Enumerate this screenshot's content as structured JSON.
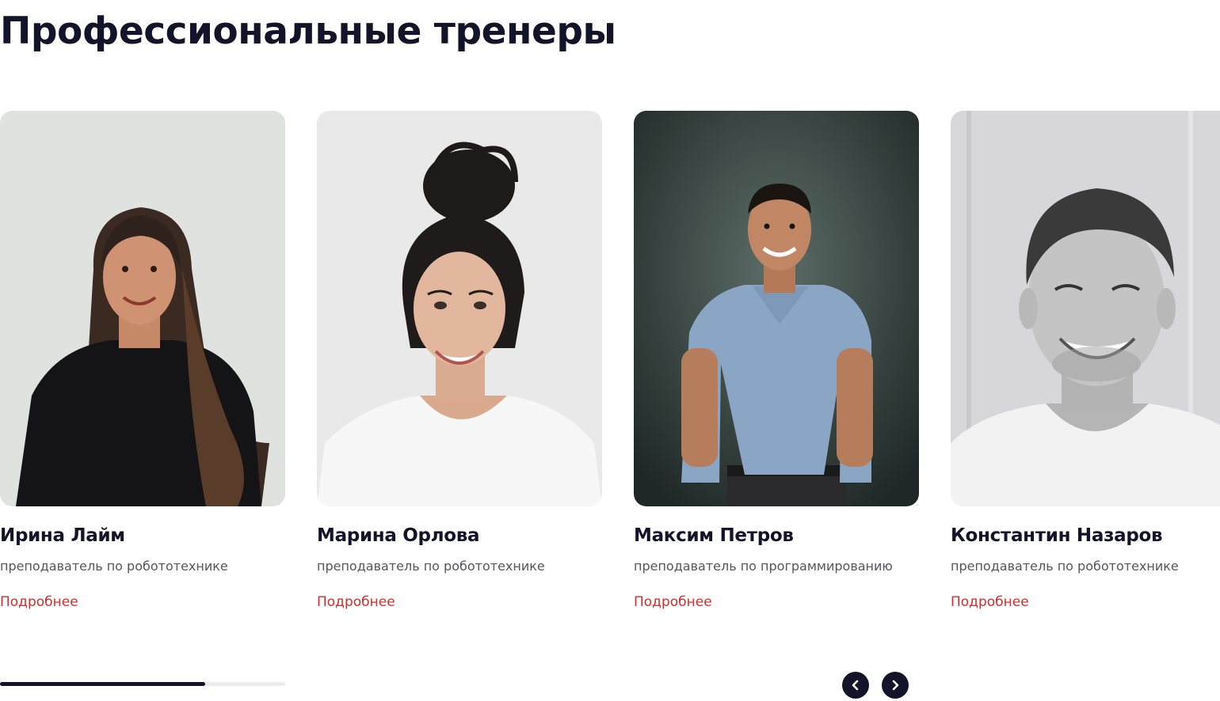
{
  "section": {
    "title": "Профессиональные тренеры"
  },
  "trainers": [
    {
      "name": "Ирина Лайм",
      "role": "преподаватель по робототехнике",
      "link": "Подробнее"
    },
    {
      "name": "Марина Орлова",
      "role": "преподаватель по робототехнике",
      "link": "Подробнее"
    },
    {
      "name": "Максим Петров",
      "role": "преподаватель по программированию",
      "link": "Подробнее"
    },
    {
      "name": "Константин Назаров",
      "role": "преподаватель по робототехнике",
      "link": "Подробнее"
    }
  ],
  "slider": {
    "progress_fraction": 0.72,
    "prev_icon": "chevron-left-icon",
    "next_icon": "chevron-right-icon"
  },
  "colors": {
    "title": "#13132a",
    "link": "#d42a2a",
    "role": "#55555f",
    "nav_button": "#13132a",
    "progress_track": "#ececef"
  }
}
